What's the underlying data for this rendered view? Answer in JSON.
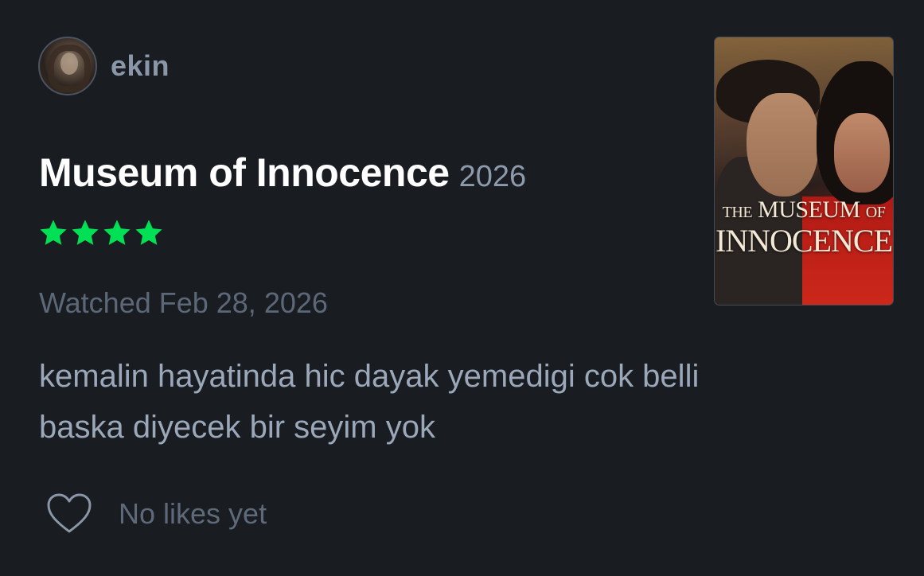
{
  "user": {
    "name": "ekin",
    "avatar_icon": "user-avatar"
  },
  "film": {
    "title": "Museum of Innocence",
    "year": "2026",
    "poster_title_the": "THE",
    "poster_title_museum": "MUSEUM",
    "poster_title_of": "OF",
    "poster_title_innocence": "INNOCENCE"
  },
  "rating": {
    "stars": 4,
    "max_stars": 5,
    "color": "#00e054"
  },
  "watched": "Watched Feb 28, 2026",
  "review": {
    "line1": "kemalin hayatinda hic dayak yemedigi cok belli",
    "line2": "baska diyecek bir seyim yok"
  },
  "likes": {
    "label": "No likes yet",
    "icon": "heart-icon"
  },
  "colors": {
    "background": "#191c21",
    "star_green": "#00e054",
    "username": "#8a97a8",
    "muted_text": "#5c6878",
    "review_text": "#9aa8ba"
  }
}
